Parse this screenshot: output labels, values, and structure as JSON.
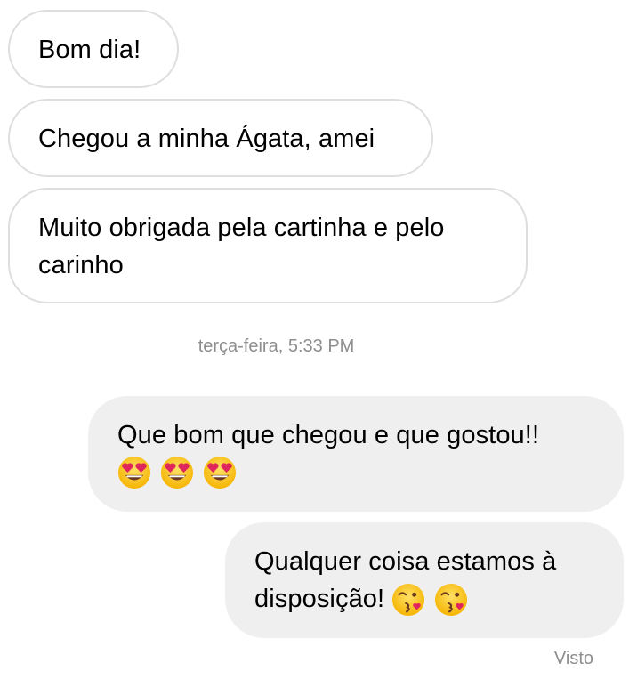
{
  "messages": {
    "incoming": [
      {
        "lines": [
          "Bom dia!"
        ]
      },
      {
        "lines": [
          "Chegou a minha Ágata, amei"
        ]
      },
      {
        "lines": [
          "Muito obrigada pela cartinha e pelo",
          "carinho"
        ]
      }
    ],
    "timestamp": "terça-feira, 5:33 PM",
    "outgoing": [
      {
        "lines": [
          "Que bom que chegou e que gostou!!"
        ],
        "emojis": [
          "heart-eyes-face",
          "heart-eyes-face",
          "heart-eyes-face"
        ]
      },
      {
        "lines": [
          "Qualquer coisa estamos à",
          "disposição!"
        ],
        "emojis": [
          "kissing-heart-face",
          "kissing-heart-face"
        ]
      }
    ],
    "seen_label": "Visto"
  },
  "colors": {
    "incoming_bubble_bg": "#ffffff",
    "incoming_bubble_border": "#dedede",
    "outgoing_bubble_bg": "#efefef",
    "meta_text": "#8e8e8e",
    "emoji_face": "#ffcc33",
    "heart": "#e0245e"
  }
}
